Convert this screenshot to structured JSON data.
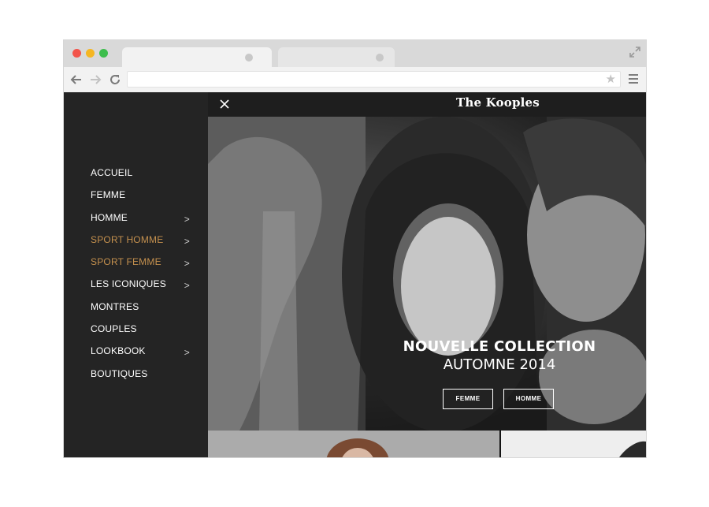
{
  "browser": {
    "url": "",
    "icons": {
      "back": "arrow-left-icon",
      "forward": "arrow-right-icon",
      "reload": "reload-icon",
      "star": "star-icon",
      "menu": "hamburger-menu-icon",
      "expand": "expand-icon"
    }
  },
  "site": {
    "logo": "The Kooples",
    "menu": [
      {
        "label": "ACCUEIL",
        "chevron": false,
        "accent": false
      },
      {
        "label": "FEMME",
        "chevron": false,
        "accent": false
      },
      {
        "label": "HOMME",
        "chevron": true,
        "accent": false
      },
      {
        "label": "SPORT HOMME",
        "chevron": true,
        "accent": true
      },
      {
        "label": "SPORT FEMME",
        "chevron": true,
        "accent": true
      },
      {
        "label": "LES ICONIQUES",
        "chevron": true,
        "accent": false
      },
      {
        "label": "MONTRES",
        "chevron": false,
        "accent": false
      },
      {
        "label": "COUPLES",
        "chevron": false,
        "accent": false
      },
      {
        "label": "LOOKBOOK",
        "chevron": true,
        "accent": false
      },
      {
        "label": "BOUTIQUES",
        "chevron": false,
        "accent": false
      }
    ],
    "chevron_glyph": ">",
    "hero": {
      "title": "NOUVELLE COLLECTION",
      "subtitle": "AUTOMNE 2014",
      "buttons": [
        "FEMME",
        "HOMME"
      ]
    },
    "colors": {
      "accent": "#c4904e",
      "sidebar_bg": "#242424"
    }
  }
}
